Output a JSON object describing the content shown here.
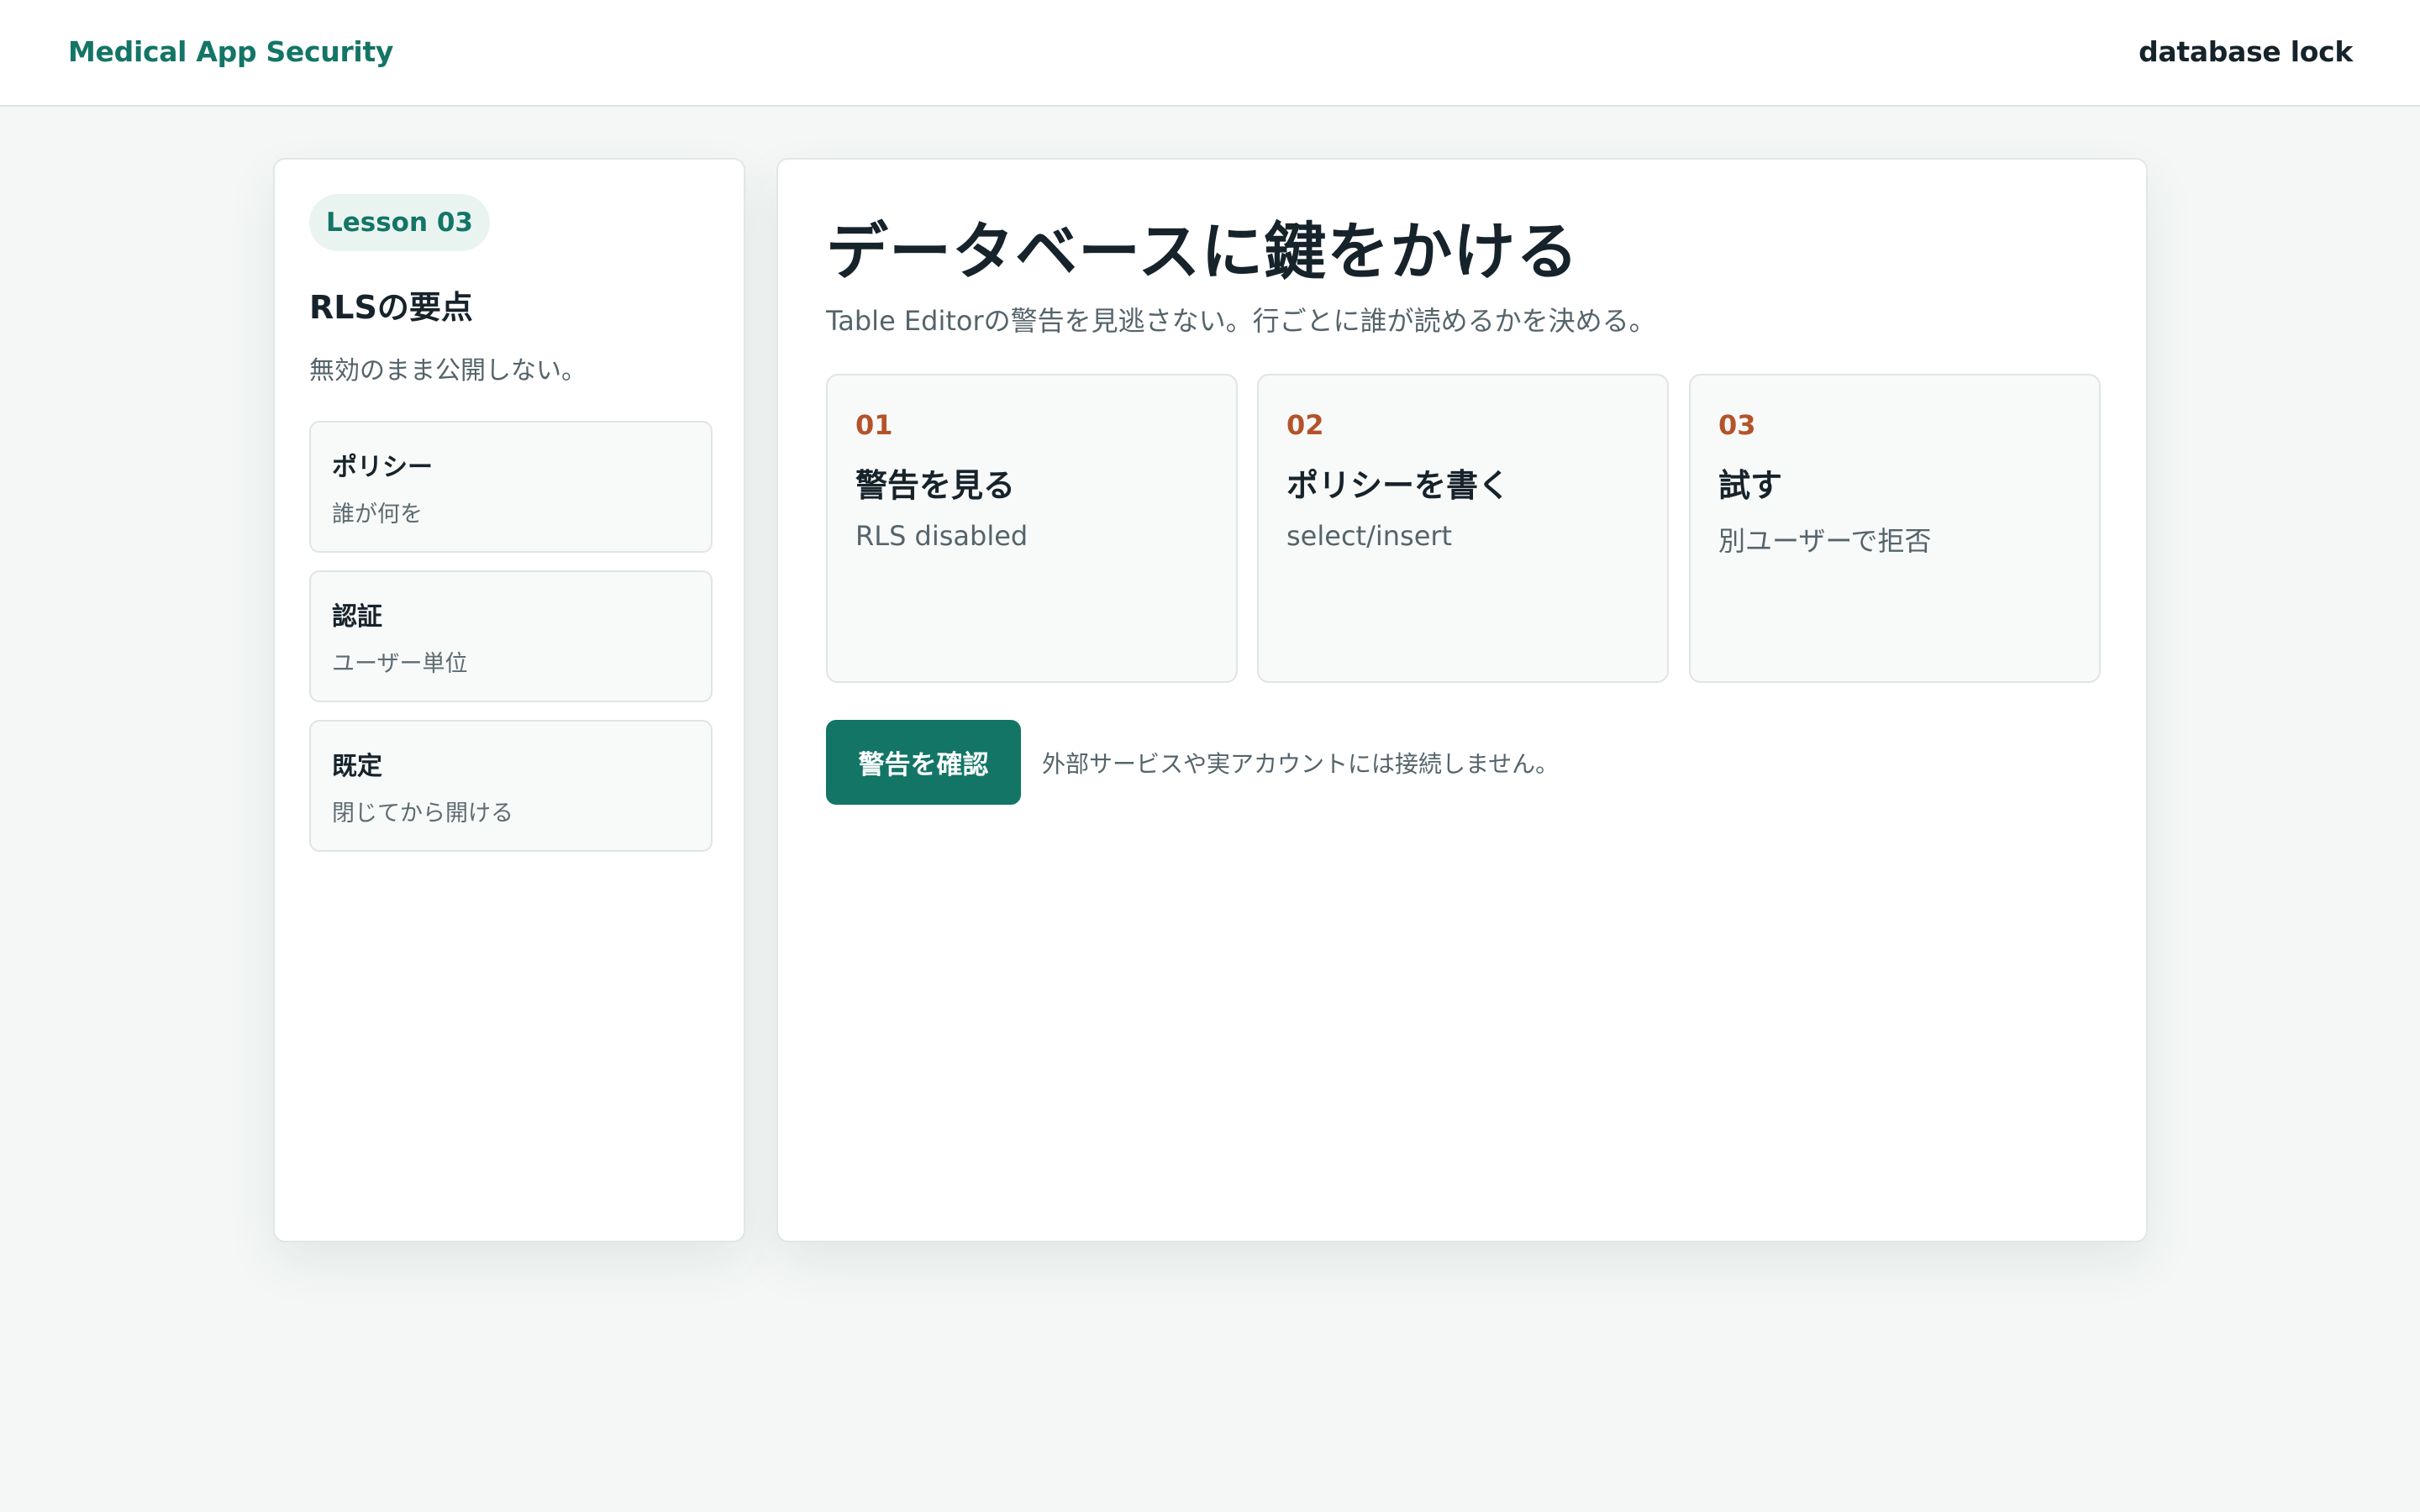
{
  "header": {
    "brand": "Medical App Security",
    "right_label": "database lock"
  },
  "sidebar": {
    "lesson_badge": "Lesson 03",
    "title": "RLSの要点",
    "subtitle": "無効のまま公開しない。",
    "cards": [
      {
        "title": "ポリシー",
        "subtitle": "誰が何を"
      },
      {
        "title": "認証",
        "subtitle": "ユーザー単位"
      },
      {
        "title": "既定",
        "subtitle": "閉じてから開ける"
      }
    ]
  },
  "main": {
    "title": "データベースに鍵をかける",
    "subtitle": "Table Editorの警告を見逃さない。行ごとに誰が読めるかを決める。",
    "steps": [
      {
        "number": "01",
        "title": "警告を見る",
        "subtitle": "RLS disabled"
      },
      {
        "number": "02",
        "title": "ポリシーを書く",
        "subtitle": "select/insert"
      },
      {
        "number": "03",
        "title": "試す",
        "subtitle": "別ユーザーで拒否"
      }
    ],
    "action_button": "警告を確認",
    "action_note": "外部サービスや実アカウントには接続しません。"
  },
  "colors": {
    "accent": "#137566",
    "step_number": "#b4532a",
    "background": "#f4f7f6",
    "text": "#17232b"
  }
}
